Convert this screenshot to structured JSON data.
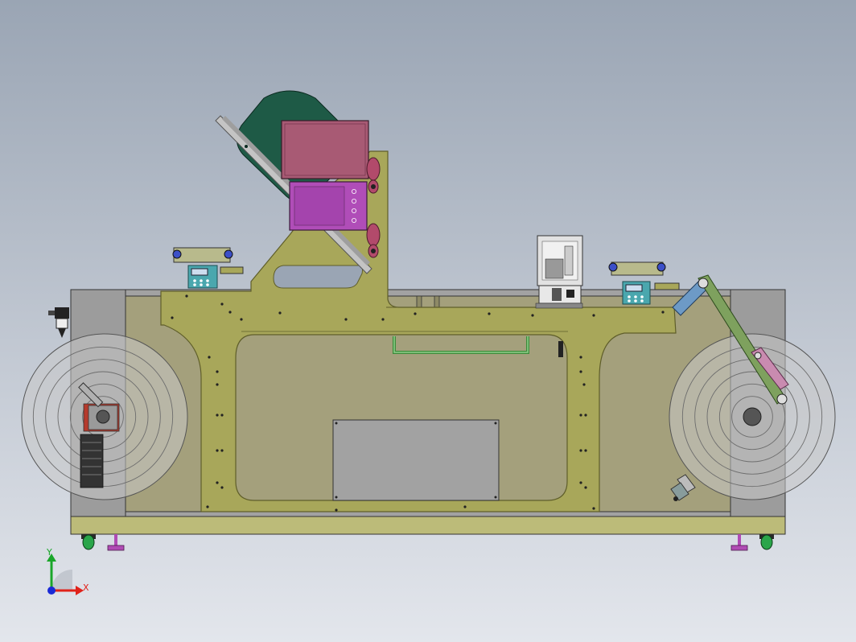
{
  "viewport": {
    "background_top": "#9aa5b4",
    "background_bottom": "#e3e6ec"
  },
  "colors": {
    "frame_olive": "#a8a75a",
    "frame_olive_dark": "#5f5e2a",
    "panel_khaki": "#a4a07c",
    "cabinet_gray": "#a2a2a2",
    "dark_green_cover": "#1e5a46",
    "magenta_panel": "#a85a74",
    "purple_screen": "#b04db8",
    "controller_teal": "#4aa7ae",
    "blue_fastener": "#3b4fc8",
    "arm_green": "#7ea15e",
    "arm_blue": "#6d9ac6",
    "arm_pink": "#c98bb0",
    "base_olive": "#bcbb79",
    "caster_green": "#2aa54a",
    "foot_purple": "#b04bb4",
    "reel_gray": "#c8c8c8",
    "axis_x": "#e0221a",
    "axis_y": "#1aa62a",
    "axis_z": "#1a2ad6"
  },
  "icons": {
    "triad": "coordinate-triad-icon"
  },
  "triad": {
    "x_label": "X",
    "y_label": "Y"
  },
  "left_reel": {
    "rings": 5
  },
  "right_reel": {
    "rings": 5
  }
}
